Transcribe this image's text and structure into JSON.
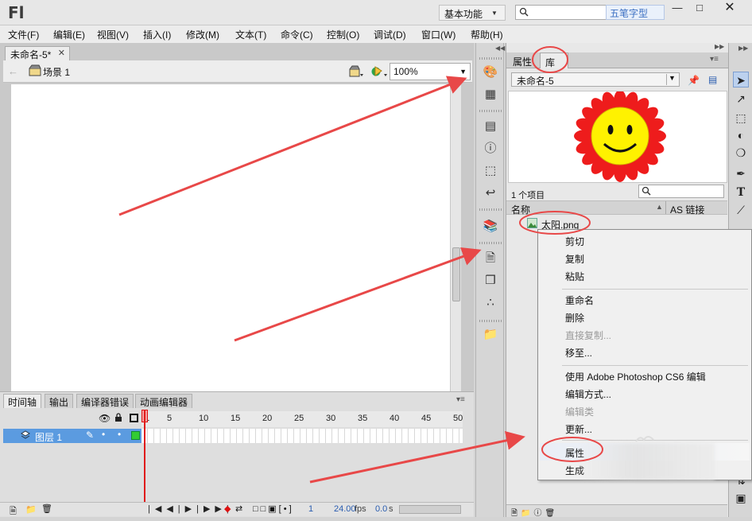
{
  "app": {
    "logo": "Fl",
    "workspace": "基本功能",
    "ime_label": "五笔字型"
  },
  "menu": [
    "文件(F)",
    "编辑(E)",
    "视图(V)",
    "插入(I)",
    "修改(M)",
    "文本(T)",
    "命令(C)",
    "控制(O)",
    "调试(D)",
    "窗口(W)",
    "帮助(H)"
  ],
  "document": {
    "tab": "未命名-5*",
    "scene": "场景 1",
    "zoom": "100%"
  },
  "timeline": {
    "tabs": [
      "时间轴",
      "输出",
      "编译器错误",
      "动画编辑器"
    ],
    "ruler": [
      "1",
      "5",
      "10",
      "15",
      "20",
      "25",
      "30",
      "35",
      "40",
      "45",
      "50"
    ],
    "layer": "图层 1",
    "frame": "1",
    "fps": "24.00",
    "fps_unit": "fps",
    "time": "0.0",
    "time_unit": "s"
  },
  "library": {
    "tabs": [
      "属性",
      "库"
    ],
    "doc_select": "未命名-5",
    "count": "1 个项目",
    "col_name": "名称",
    "col_link": "AS 链接",
    "item": "太阳.png"
  },
  "context_menu": {
    "items": [
      {
        "label": "剪切",
        "disabled": false
      },
      {
        "label": "复制",
        "disabled": false
      },
      {
        "label": "粘贴",
        "disabled": false
      },
      {
        "label": "重命名",
        "disabled": false
      },
      {
        "label": "删除",
        "disabled": false
      },
      {
        "label": "直接复制...",
        "disabled": true
      },
      {
        "label": "移至...",
        "disabled": false
      },
      {
        "label": "使用 Adobe Photoshop CS6 编辑",
        "disabled": false
      },
      {
        "label": "编辑方式...",
        "disabled": false
      },
      {
        "label": "编辑类",
        "disabled": true
      },
      {
        "label": "更新...",
        "disabled": false
      },
      {
        "label": "属性",
        "disabled": false
      },
      {
        "label": "生成",
        "disabled": false
      }
    ]
  },
  "colors": {
    "annotation": "#e84848",
    "selection": "#5b9be0",
    "sun_petals": "#ee1c1c",
    "sun_face": "#fff200"
  }
}
